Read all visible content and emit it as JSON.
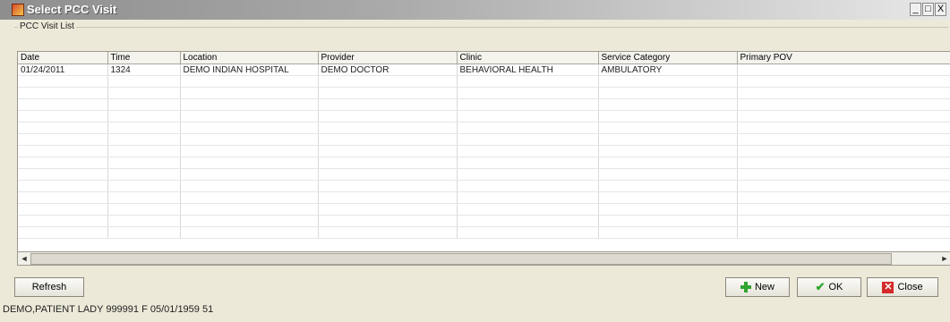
{
  "window": {
    "title": "Select PCC Visit",
    "controls": [
      "_",
      "□",
      "X"
    ]
  },
  "group": {
    "label": "PCC Visit List"
  },
  "table": {
    "columns": [
      "Date",
      "Time",
      "Location",
      "Provider",
      "Clinic",
      "Service Category",
      "Primary POV"
    ],
    "rows": [
      [
        "01/24/2011",
        "1324",
        "DEMO INDIAN HOSPITAL",
        "DEMO DOCTOR",
        "BEHAVIORAL HEALTH",
        "AMBULATORY",
        ""
      ]
    ]
  },
  "scrollbar": {
    "left_arrow": "◄",
    "right_arrow": "►"
  },
  "buttons": {
    "refresh": "Refresh",
    "new": "New",
    "ok": "OK",
    "close": "Close"
  },
  "status": {
    "patient": "DEMO,PATIENT LADY  999991  F  05/01/1959  51"
  }
}
